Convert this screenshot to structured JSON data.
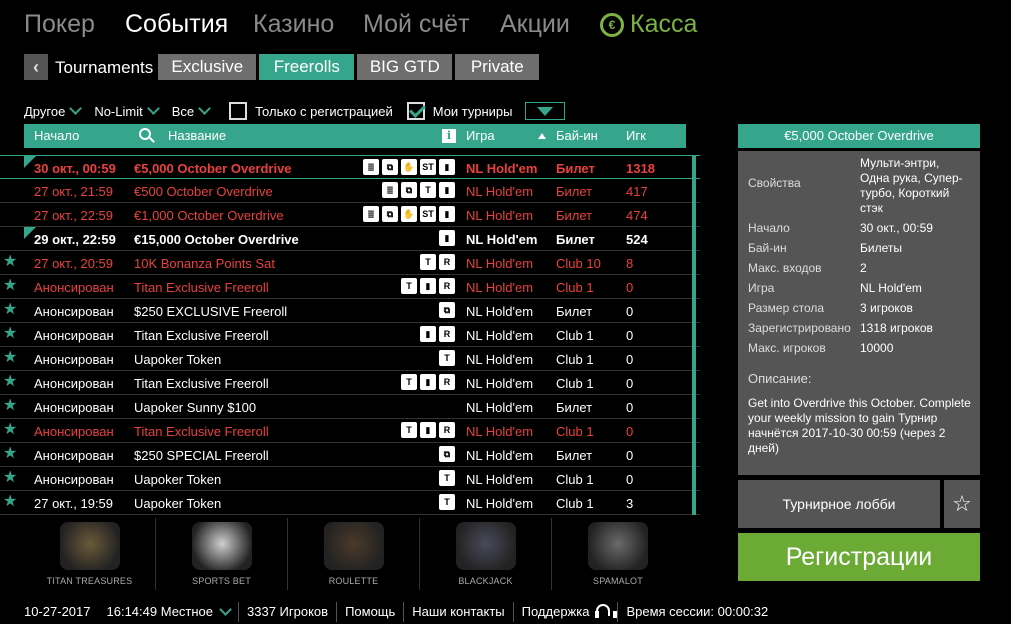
{
  "topnav": {
    "items": [
      "Покер",
      "События",
      "Казино",
      "Мой счёт",
      "Акции"
    ],
    "active": "События",
    "kassa_label": "Касса",
    "kassa_icon": "euro-coin-icon"
  },
  "subnav": {
    "label": "Tournaments",
    "tabs": [
      "Exclusive",
      "Freerolls",
      "BIG GTD",
      "Private"
    ],
    "active_tab": "Freerolls"
  },
  "filters": {
    "other": "Другое",
    "limit": "No-Limit",
    "all": "Все",
    "registered_only": "Только с регистрацией",
    "registered_only_checked": false,
    "my_tournaments": "Мои турниры",
    "my_tournaments_checked": true
  },
  "table": {
    "headers": {
      "start": "Начало",
      "name": "Название",
      "info": "i",
      "game": "Игра",
      "buyin": "Бай-ин",
      "players": "Игк"
    },
    "rows": [
      {
        "start": "30 окт., 00:59",
        "name": "€5,000 October Overdrive",
        "badges": [
          "≣",
          "⧉",
          "✋",
          "ST",
          "▮"
        ],
        "game": "NL Hold'em",
        "buyin": "Билет",
        "players": "1318",
        "style": "red bold",
        "marker": "triangle",
        "highlight": true
      },
      {
        "start": "27 окт., 21:59",
        "name": "€500 October Overdrive",
        "badges": [
          "≣",
          "⧉",
          "T",
          "▮"
        ],
        "game": "NL Hold'em",
        "buyin": "Билет",
        "players": "417",
        "style": "red",
        "marker": "",
        "highlight": false
      },
      {
        "start": "27 окт., 22:59",
        "name": "€1,000 October Overdrive",
        "badges": [
          "≣",
          "⧉",
          "✋",
          "ST",
          "▮"
        ],
        "game": "NL Hold'em",
        "buyin": "Билет",
        "players": "474",
        "style": "red",
        "marker": "",
        "highlight": false
      },
      {
        "start": "29 окт., 22:59",
        "name": "€15,000 October Overdrive",
        "badges": [
          "▮"
        ],
        "game": "NL Hold'em",
        "buyin": "Билет",
        "players": "524",
        "style": "bold",
        "marker": "triangle",
        "highlight": false
      },
      {
        "start": "27 окт., 20:59",
        "name": "10K Bonanza Points Sat",
        "badges": [
          "T",
          "R"
        ],
        "game": "NL Hold'em",
        "buyin": "Club 10",
        "players": "8",
        "style": "red",
        "marker": "star",
        "highlight": false
      },
      {
        "start": "Анонсирован",
        "name": "Titan Exclusive Freeroll",
        "badges": [
          "T",
          "▮",
          "R"
        ],
        "game": "NL Hold'em",
        "buyin": "Club 1",
        "players": "0",
        "style": "red",
        "marker": "star",
        "highlight": false
      },
      {
        "start": "Анонсирован",
        "name": "$250 EXCLUSIVE Freeroll",
        "badges": [
          "⧉"
        ],
        "game": "NL Hold'em",
        "buyin": "Билет",
        "players": "0",
        "style": "",
        "marker": "star",
        "highlight": false
      },
      {
        "start": "Анонсирован",
        "name": "Titan Exclusive Freeroll",
        "badges": [
          "▮",
          "R"
        ],
        "game": "NL Hold'em",
        "buyin": "Club 1",
        "players": "0",
        "style": "",
        "marker": "star",
        "highlight": false
      },
      {
        "start": "Анонсирован",
        "name": "Uapoker Token",
        "badges": [
          "T"
        ],
        "game": "NL Hold'em",
        "buyin": "Club 1",
        "players": "0",
        "style": "",
        "marker": "star",
        "highlight": false
      },
      {
        "start": "Анонсирован",
        "name": "Titan Exclusive Freeroll",
        "badges": [
          "T",
          "▮",
          "R"
        ],
        "game": "NL Hold'em",
        "buyin": "Club 1",
        "players": "0",
        "style": "",
        "marker": "star",
        "highlight": false
      },
      {
        "start": "Анонсирован",
        "name": "Uapoker Sunny $100",
        "badges": [],
        "game": "NL Hold'em",
        "buyin": "Билет",
        "players": "0",
        "style": "",
        "marker": "star",
        "highlight": false
      },
      {
        "start": "Анонсирован",
        "name": "Titan Exclusive Freeroll",
        "badges": [
          "T",
          "▮",
          "R"
        ],
        "game": "NL Hold'em",
        "buyin": "Club 1",
        "players": "0",
        "style": "red",
        "marker": "star",
        "highlight": false
      },
      {
        "start": "Анонсирован",
        "name": "$250 SPECIAL Freeroll",
        "badges": [
          "⧉"
        ],
        "game": "NL Hold'em",
        "buyin": "Билет",
        "players": "0",
        "style": "",
        "marker": "star",
        "highlight": false
      },
      {
        "start": "Анонсирован",
        "name": "Uapoker Token",
        "badges": [
          "T"
        ],
        "game": "NL Hold'em",
        "buyin": "Club 1",
        "players": "0",
        "style": "",
        "marker": "star",
        "highlight": false
      },
      {
        "start": "27 окт., 19:59",
        "name": "Uapoker Token",
        "badges": [
          "T"
        ],
        "game": "NL Hold'em",
        "buyin": "Club 1",
        "players": "3",
        "style": "",
        "marker": "star",
        "highlight": false
      }
    ]
  },
  "games": [
    {
      "label": "TITAN TREASURES",
      "icon": "treasure-chest-icon",
      "color": "#6b5a3a"
    },
    {
      "label": "SPORTS BET",
      "icon": "sports-balls-icon",
      "color": "#cfcfcf"
    },
    {
      "label": "ROULETTE",
      "icon": "roulette-wheel-icon",
      "color": "#4a3a2a"
    },
    {
      "label": "BLACKJACK",
      "icon": "playing-cards-icon",
      "color": "#4a4a5a"
    },
    {
      "label": "SPAMALOT",
      "icon": "knights-icon",
      "color": "#6a6a6a"
    }
  ],
  "details": {
    "title": "€5,000 October Overdrive",
    "fields": [
      {
        "key": "Свойства",
        "value": "Мульти-энтри, Одна рука, Супер-турбо, Короткий стэк"
      },
      {
        "key": "Начало",
        "value": "30 окт., 00:59"
      },
      {
        "key": "Бай-ин",
        "value": "Билеты"
      },
      {
        "key": "Макс. входов",
        "value": "2"
      },
      {
        "key": "Игра",
        "value": "NL Hold'em"
      },
      {
        "key": "Размер стола",
        "value": "3 игроков"
      },
      {
        "key": "Зарегистрировано",
        "value": "1318 игроков"
      },
      {
        "key": "Макс. игроков",
        "value": "10000"
      }
    ],
    "description_title": "Описание:",
    "description": "Get into Overdrive this October. Complete your weekly mission to gain Турнир начнётся 2017-10-30 00:59 (через 2 дней)",
    "lobby_button": "Турнирное лобби",
    "register_button": "Регистрации"
  },
  "status_bar": {
    "date": "10-27-2017",
    "time": "16:14:49 Местное",
    "players": "3337 Игроков",
    "help": "Помощь",
    "contacts": "Наши контакты",
    "support": "Поддержка",
    "session": "Время сессии: 00:00:32"
  },
  "colors": {
    "accent": "#35a68c",
    "red": "#e8413f",
    "green_button": "#6aaa35",
    "panel": "#555555"
  }
}
